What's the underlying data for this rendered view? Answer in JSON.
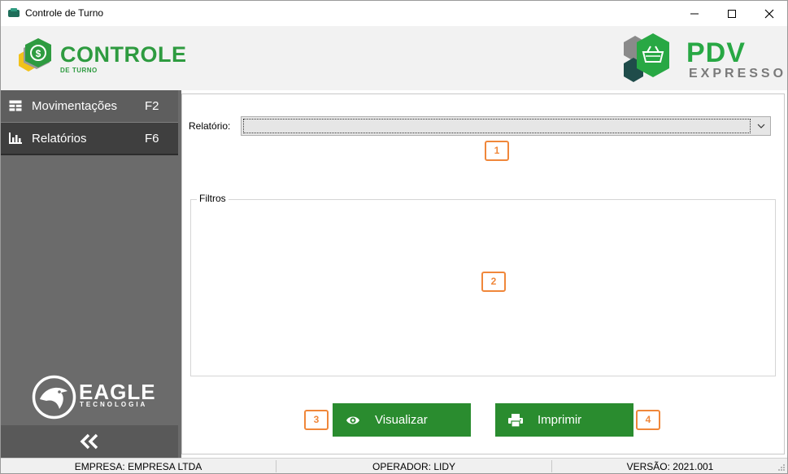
{
  "window": {
    "title": "Controle de Turno",
    "controls": {
      "minimize": "minimize-icon",
      "maximize": "maximize-icon",
      "close": "close-icon"
    }
  },
  "header": {
    "app_logo_title": "CONTROLE",
    "app_logo_subtitle": "DE TURNO",
    "brand_logo_title": "PDV",
    "brand_logo_subtitle": "EXPRESSO",
    "colors": {
      "green": "#2e9b40",
      "brand_green": "#28a844",
      "gray": "#7a7a7a"
    }
  },
  "sidebar": {
    "items": [
      {
        "label": "Movimentações",
        "shortcut": "F2",
        "icon": "table-icon",
        "active": false
      },
      {
        "label": "Relatórios",
        "shortcut": "F6",
        "icon": "bar-chart-icon",
        "active": true
      }
    ],
    "company_logo_title": "EAGLE",
    "company_logo_subtitle": "TECNOLOGIA",
    "collapse_icon": "double-chevron-left-icon",
    "colors": {
      "background": "#6b6b6b",
      "active": "#3f3f3f"
    }
  },
  "main": {
    "report_label": "Relatório:",
    "report_value": "",
    "filters_legend": "Filtros",
    "buttons": {
      "view_label": "Visualizar",
      "view_icon": "eye-icon",
      "print_label": "Imprimir",
      "print_icon": "printer-icon",
      "color": "#2a8c2f"
    },
    "callouts": [
      "1",
      "2",
      "3",
      "4"
    ],
    "callout_color": "#f0873a"
  },
  "statusbar": {
    "company": "EMPRESA: EMPRESA LTDA",
    "operator": "OPERADOR: LIDY",
    "version": "VERSÃO: 2021.001"
  }
}
